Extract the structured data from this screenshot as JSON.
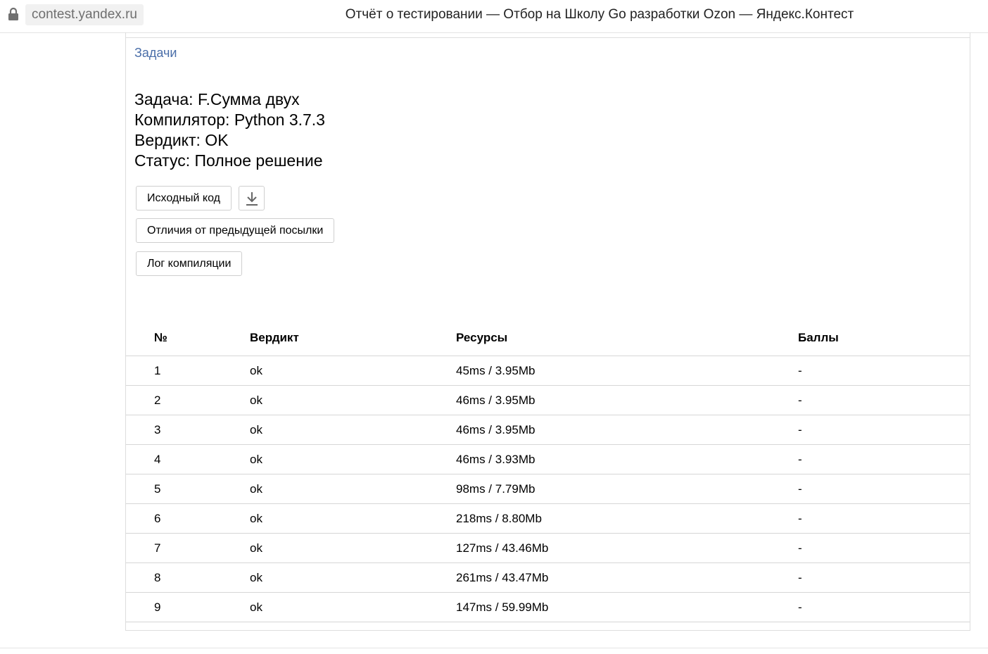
{
  "browser": {
    "url": "contest.yandex.ru",
    "title": "Отчёт о тестировании — Отбор на Школу Go разработки Ozon — Яндекс.Контест",
    "icons": {
      "lock": "lock-icon"
    }
  },
  "page": {
    "tasks_link": "Задачи",
    "info": {
      "task": "Задача: F.Сумма двух",
      "compiler": "Компилятор: Python 3.7.3",
      "verdict": "Вердикт: OK",
      "status": "Статус: Полное решение"
    },
    "buttons": {
      "source_code": "Исходный код",
      "download_icon": "download-icon",
      "diff": "Отличия от предыдущей посылки",
      "compile_log": "Лог компиляции"
    },
    "accent_color": "#4a6ea9"
  },
  "table": {
    "headers": [
      "№",
      "Вердикт",
      "Ресурсы",
      "Баллы"
    ],
    "rows": [
      [
        "1",
        "ok",
        "45ms / 3.95Mb",
        "-"
      ],
      [
        "2",
        "ok",
        "46ms / 3.95Mb",
        "-"
      ],
      [
        "3",
        "ok",
        "46ms / 3.95Mb",
        "-"
      ],
      [
        "4",
        "ok",
        "46ms / 3.93Mb",
        "-"
      ],
      [
        "5",
        "ok",
        "98ms / 7.79Mb",
        "-"
      ],
      [
        "6",
        "ok",
        "218ms / 8.80Mb",
        "-"
      ],
      [
        "7",
        "ok",
        "127ms / 43.46Mb",
        "-"
      ],
      [
        "8",
        "ok",
        "261ms / 43.47Mb",
        "-"
      ],
      [
        "9",
        "ok",
        "147ms / 59.99Mb",
        "-"
      ]
    ]
  }
}
